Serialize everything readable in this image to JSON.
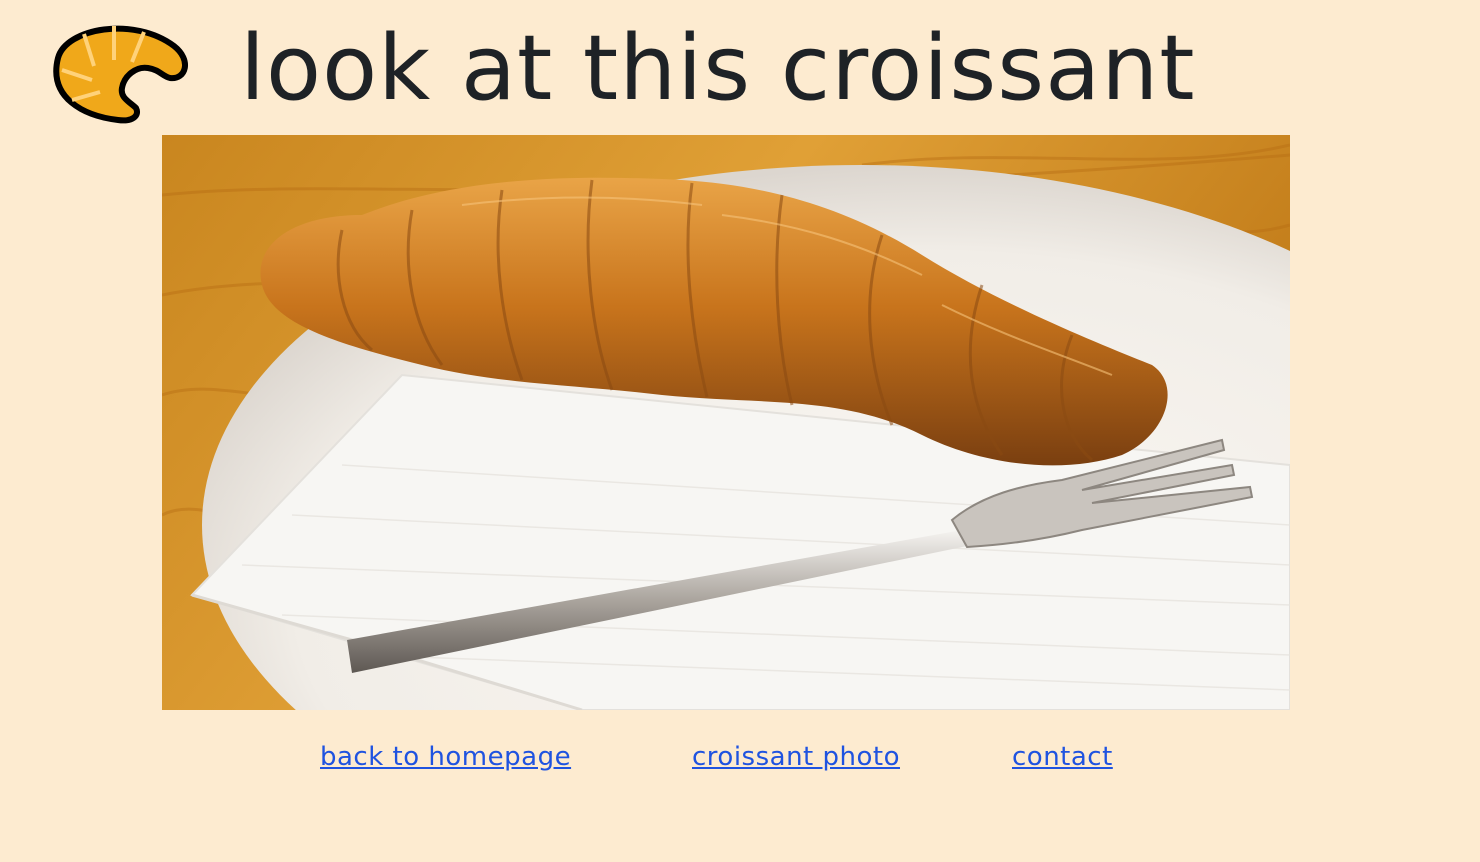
{
  "header": {
    "title": "look at this croissant",
    "logo_icon": "croissant-icon"
  },
  "photo": {
    "alt": "croissant on a white plate with a napkin and fork",
    "colors": {
      "table": "#d08a20",
      "plate": "#f4f1ec",
      "croissant": "#c8741c"
    }
  },
  "nav": {
    "links": [
      {
        "label": "back to homepage"
      },
      {
        "label": "croissant photo"
      },
      {
        "label": "contact"
      }
    ]
  },
  "colors": {
    "background": "#fdebd0",
    "title_text": "#1e2226",
    "link": "#1f53e0",
    "logo_fill": "#f0a81a"
  }
}
